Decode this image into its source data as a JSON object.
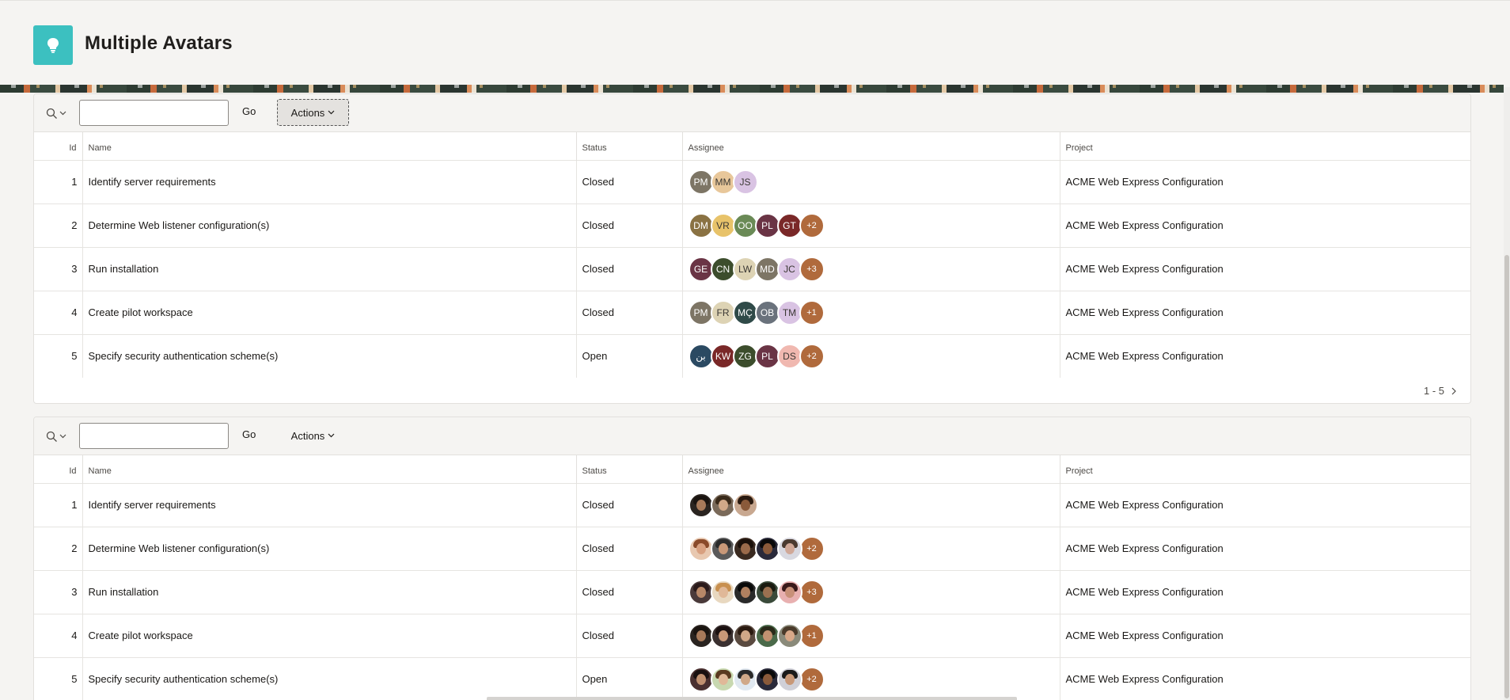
{
  "page": {
    "title": "Multiple Avatars",
    "logo_icon": "lightbulb-icon",
    "accent": "#3cc0c0"
  },
  "regions": [
    {
      "search": {
        "icon": "search-icon",
        "value": "",
        "placeholder": ""
      },
      "go_label": "Go",
      "actions_label": "Actions",
      "columns": {
        "id": "Id",
        "name": "Name",
        "status": "Status",
        "assignee": "Assignee",
        "project": "Project"
      },
      "rows": [
        {
          "id": "1",
          "name": "Identify server requirements",
          "status": "Closed",
          "project": "ACME Web Express Configuration",
          "assignees": [
            {
              "initials": "PM",
              "color": "#7d7565"
            },
            {
              "initials": "MM",
              "color": "#e8c79a",
              "light": true
            },
            {
              "initials": "JS",
              "color": "#d9c3e3",
              "light": true
            }
          ]
        },
        {
          "id": "2",
          "name": "Determine Web listener configuration(s)",
          "status": "Closed",
          "project": "ACME Web Express Configuration",
          "assignees": [
            {
              "initials": "DM",
              "color": "#8a7243"
            },
            {
              "initials": "VR",
              "color": "#e8c36a",
              "light": true
            },
            {
              "initials": "OO",
              "color": "#6a8a56"
            },
            {
              "initials": "PL",
              "color": "#6a3445"
            },
            {
              "initials": "GT",
              "color": "#7a2828"
            },
            {
              "initials": "+2",
              "color": "#b06a3c",
              "more": true
            }
          ]
        },
        {
          "id": "3",
          "name": "Run installation",
          "status": "Closed",
          "project": "ACME Web Express Configuration",
          "assignees": [
            {
              "initials": "GE",
              "color": "#6a3445"
            },
            {
              "initials": "CN",
              "color": "#3c4d2c"
            },
            {
              "initials": "LW",
              "color": "#ddd3b4",
              "light": true
            },
            {
              "initials": "MD",
              "color": "#7d7565"
            },
            {
              "initials": "JC",
              "color": "#d9c3e3",
              "light": true
            },
            {
              "initials": "+3",
              "color": "#b06a3c",
              "more": true
            }
          ]
        },
        {
          "id": "4",
          "name": "Create pilot workspace",
          "status": "Closed",
          "project": "ACME Web Express Configuration",
          "assignees": [
            {
              "initials": "PM",
              "color": "#7d7565"
            },
            {
              "initials": "FR",
              "color": "#ddd3b4",
              "light": true
            },
            {
              "initials": "MÇ",
              "color": "#2f4a48"
            },
            {
              "initials": "OB",
              "color": "#6a727c"
            },
            {
              "initials": "TM",
              "color": "#d9c3e3",
              "light": true
            },
            {
              "initials": "+1",
              "color": "#b06a3c",
              "more": true
            }
          ]
        },
        {
          "id": "5",
          "name": "Specify security authentication scheme(s)",
          "status": "Open",
          "project": "ACME Web Express Configuration",
          "assignees": [
            {
              "initials": "ﺑﻦ",
              "color": "#2b4a62"
            },
            {
              "initials": "KW",
              "color": "#7a2828"
            },
            {
              "initials": "ZG",
              "color": "#3c4d2c"
            },
            {
              "initials": "PL",
              "color": "#6a3445"
            },
            {
              "initials": "DS",
              "color": "#f0b8b0",
              "light": true
            },
            {
              "initials": "+2",
              "color": "#b06a3c",
              "more": true
            }
          ]
        }
      ],
      "pagination": {
        "label": "1 - 5"
      }
    },
    {
      "search": {
        "icon": "search-icon",
        "value": "",
        "placeholder": ""
      },
      "go_label": "Go",
      "actions_label": "Actions",
      "columns": {
        "id": "Id",
        "name": "Name",
        "status": "Status",
        "assignee": "Assignee",
        "project": "Project"
      },
      "rows": [
        {
          "id": "1",
          "name": "Identify server requirements",
          "status": "Closed",
          "project": "ACME Web Express Configuration",
          "assignees": [
            {
              "photo": true,
              "bg": "#2a2420",
              "face": "#a87a5a",
              "hair": "#1a1410"
            },
            {
              "photo": true,
              "bg": "#7a6a5a",
              "face": "#d0a888",
              "hair": "#3a2a1a"
            },
            {
              "photo": true,
              "bg": "#c8a890",
              "face": "#8a5a3a",
              "hair": "#2a1a10"
            }
          ]
        },
        {
          "id": "2",
          "name": "Determine Web listener configuration(s)",
          "status": "Closed",
          "project": "ACME Web Express Configuration",
          "assignees": [
            {
              "photo": true,
              "bg": "#e8c8b0",
              "face": "#d8a080",
              "hair": "#8a4a2a"
            },
            {
              "photo": true,
              "bg": "#5a5a5a",
              "face": "#c89878",
              "hair": "#2a2a2a"
            },
            {
              "photo": true,
              "bg": "#3a2a20",
              "face": "#9a6a4a",
              "hair": "#1a100a"
            },
            {
              "photo": true,
              "bg": "#2a2a3a",
              "face": "#8a5a3a",
              "hair": "#0a0a0a"
            },
            {
              "photo": true,
              "bg": "#d8d8e0",
              "face": "#d0a898",
              "hair": "#4a3a30"
            },
            {
              "initials": "+2",
              "color": "#b06a3c",
              "more": true
            }
          ]
        },
        {
          "id": "3",
          "name": "Run installation",
          "status": "Closed",
          "project": "ACME Web Express Configuration",
          "assignees": [
            {
              "photo": true,
              "bg": "#4a3a3a",
              "face": "#b88868",
              "hair": "#2a1a1a"
            },
            {
              "photo": true,
              "bg": "#e8d8c0",
              "face": "#e0b898",
              "hair": "#c89050"
            },
            {
              "photo": true,
              "bg": "#2a2a2a",
              "face": "#b08060",
              "hair": "#0a0a0a"
            },
            {
              "photo": true,
              "bg": "#3a4a3a",
              "face": "#9a7050",
              "hair": "#1a1a10"
            },
            {
              "photo": true,
              "bg": "#e8b0b0",
              "face": "#c89078",
              "hair": "#3a1a1a"
            },
            {
              "initials": "+3",
              "color": "#b06a3c",
              "more": true
            }
          ]
        },
        {
          "id": "4",
          "name": "Create pilot workspace",
          "status": "Closed",
          "project": "ACME Web Express Configuration",
          "assignees": [
            {
              "photo": true,
              "bg": "#2a2420",
              "face": "#a87a5a",
              "hair": "#1a1410"
            },
            {
              "photo": true,
              "bg": "#3a3030",
              "face": "#c89878",
              "hair": "#1a1010"
            },
            {
              "photo": true,
              "bg": "#5a4a40",
              "face": "#d0a888",
              "hair": "#2a1a10"
            },
            {
              "photo": true,
              "bg": "#4a6a4a",
              "face": "#c09070",
              "hair": "#2a2a1a"
            },
            {
              "photo": true,
              "bg": "#8a8a7a",
              "face": "#d8a888",
              "hair": "#4a3a2a"
            },
            {
              "initials": "+1",
              "color": "#b06a3c",
              "more": true
            }
          ]
        },
        {
          "id": "5",
          "name": "Specify security authentication scheme(s)",
          "status": "Open",
          "project": "ACME Web Express Configuration",
          "assignees": [
            {
              "photo": true,
              "bg": "#4a3030",
              "face": "#c09070",
              "hair": "#1a1010"
            },
            {
              "photo": true,
              "bg": "#c8d8b0",
              "face": "#e0b898",
              "hair": "#5a3a20"
            },
            {
              "photo": true,
              "bg": "#e0e8f0",
              "face": "#d0a888",
              "hair": "#2a2a2a"
            },
            {
              "photo": true,
              "bg": "#2a2a3a",
              "face": "#8a5a3a",
              "hair": "#0a0a0a"
            },
            {
              "photo": true,
              "bg": "#d0d0d8",
              "face": "#c89878",
              "hair": "#1a1a1a"
            },
            {
              "initials": "+2",
              "color": "#b06a3c",
              "more": true
            }
          ]
        }
      ]
    }
  ]
}
